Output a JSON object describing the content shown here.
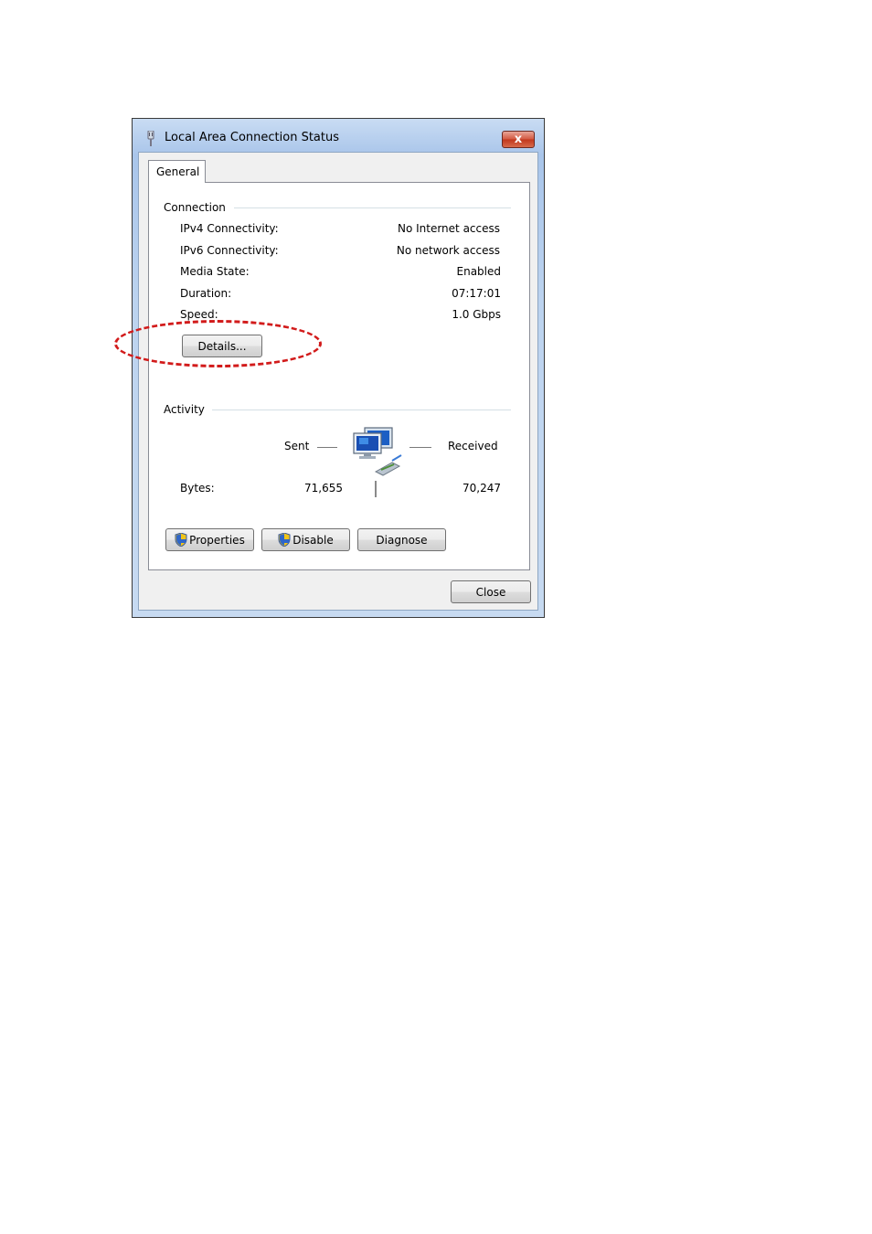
{
  "window": {
    "title": "Local Area Connection Status",
    "close_glyph": "x"
  },
  "tabs": [
    {
      "label": "General"
    }
  ],
  "connection": {
    "heading": "Connection",
    "rows": [
      {
        "label": "IPv4 Connectivity:",
        "value": "No Internet access"
      },
      {
        "label": "IPv6 Connectivity:",
        "value": "No network access"
      },
      {
        "label": "Media State:",
        "value": "Enabled"
      },
      {
        "label": "Duration:",
        "value": "07:17:01"
      },
      {
        "label": "Speed:",
        "value": "1.0 Gbps"
      }
    ],
    "details_button": "Details..."
  },
  "activity": {
    "heading": "Activity",
    "sent_label": "Sent",
    "received_label": "Received",
    "bytes_label": "Bytes:",
    "bytes_sent": "71,655",
    "bytes_received": "70,247"
  },
  "buttons": {
    "properties": "Properties",
    "disable": "Disable",
    "diagnose": "Diagnose",
    "close": "Close"
  },
  "icons": {
    "window_icon": "network-plug-icon",
    "activity_icon": "network-computers-icon",
    "shield_icon": "uac-shield-icon"
  },
  "colors": {
    "annotation": "#d21b1b",
    "close_button": "#c1371c",
    "frame": "#bcd3ef"
  }
}
